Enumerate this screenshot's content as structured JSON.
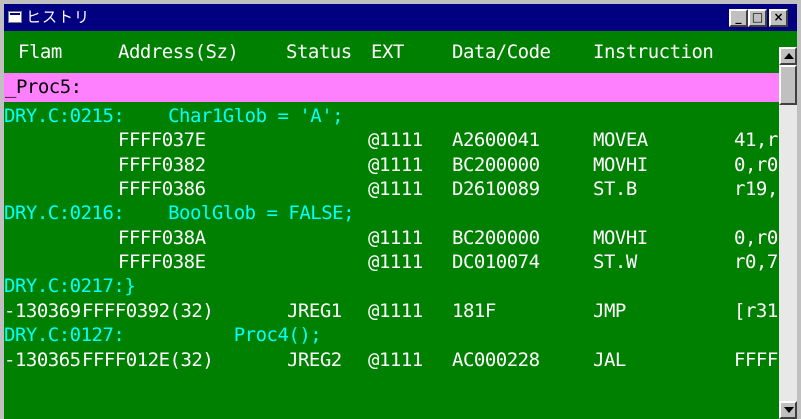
{
  "window": {
    "title": "ヒストリ",
    "buttons": {
      "minimize": "_",
      "maximize": "□",
      "close": "×"
    }
  },
  "header": {
    "flam": "Flam",
    "address": "Address(Sz)",
    "status": "Status",
    "ext": "EXT",
    "data": "Data/Code",
    "instruction": "Instruction"
  },
  "proc_label": "_Proc5:",
  "rows": [
    {
      "type": "src",
      "text": "DRY.C:0215:    Char1Glob = 'A';"
    },
    {
      "type": "code",
      "flam": "",
      "address": "FFFF037E",
      "status": "",
      "ext": "@1111",
      "data": "A2600041",
      "instr": "MOVEA",
      "operand": "41,r"
    },
    {
      "type": "code",
      "flam": "",
      "address": "FFFF0382",
      "status": "",
      "ext": "@1111",
      "data": "BC200000",
      "instr": "MOVHI",
      "operand": "0,r0"
    },
    {
      "type": "code",
      "flam": "",
      "address": "FFFF0386",
      "status": "",
      "ext": "@1111",
      "data": "D2610089",
      "instr": "ST.B",
      "operand": "r19,"
    },
    {
      "type": "src",
      "text": "DRY.C:0216:    BoolGlob = FALSE;"
    },
    {
      "type": "code",
      "flam": "",
      "address": "FFFF038A",
      "status": "",
      "ext": "@1111",
      "data": "BC200000",
      "instr": "MOVHI",
      "operand": "0,r0"
    },
    {
      "type": "code",
      "flam": "",
      "address": "FFFF038E",
      "status": "",
      "ext": "@1111",
      "data": "DC010074",
      "instr": "ST.W",
      "operand": "r0,7"
    },
    {
      "type": "src",
      "text": "DRY.C:0217:}"
    },
    {
      "type": "code",
      "flam": "-130369",
      "address": "FFFF0392(32)",
      "status": "JREG1",
      "ext": "@1111",
      "data": "181F",
      "instr": "JMP",
      "operand": "[r31"
    },
    {
      "type": "src",
      "text": "DRY.C:0127:          Proc4();"
    },
    {
      "type": "code",
      "flam": "-130365",
      "address": "FFFF012E(32)",
      "status": "JREG2",
      "ext": "@1111",
      "data": "AC000228",
      "instr": "JAL",
      "operand": "FFFF"
    }
  ]
}
